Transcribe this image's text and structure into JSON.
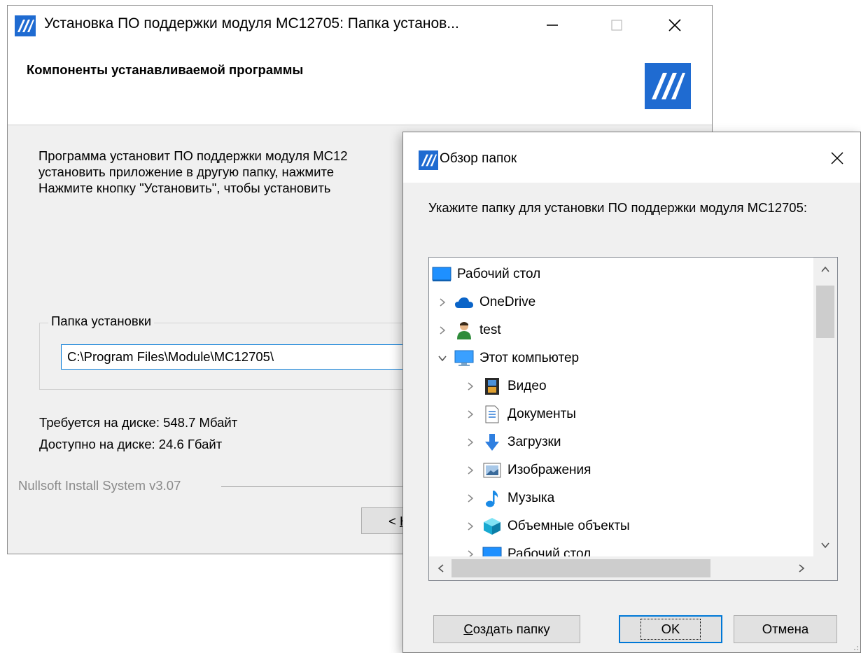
{
  "installer": {
    "title": "Установка ПО поддержки модуля MC12705: Папка установ...",
    "header_title": "Компоненты устанавливаемой программы",
    "description_lines": [
      "Программа установит ПО поддержки модуля MC12",
      "установить приложение в другую папку, нажмите",
      "Нажмите кнопку \"Установить\", чтобы установить"
    ],
    "group_label": "Папка установки",
    "install_path": "C:\\Program Files\\Module\\MC12705\\",
    "space_required": "Требуется на диске: 548.7 Мбайт",
    "space_available": "Доступно на диске: 24.6 Гбайт",
    "branding": "Nullsoft Install System v3.07",
    "back_button": {
      "prefix": "< ",
      "underlined": "Н"
    }
  },
  "browse_dialog": {
    "title": "Обзор папок",
    "prompt": "Укажите папку для установки ПО поддержки модуля MC12705:",
    "tree": [
      {
        "label": "Рабочий стол",
        "icon": "desktop-icon",
        "level": 0,
        "chevron": "none"
      },
      {
        "label": "OneDrive",
        "icon": "cloud-icon",
        "level": 1,
        "chevron": "right"
      },
      {
        "label": "test",
        "icon": "user-icon",
        "level": 1,
        "chevron": "right"
      },
      {
        "label": "Этот компьютер",
        "icon": "computer-icon",
        "level": 1,
        "chevron": "down"
      },
      {
        "label": "Видео",
        "icon": "video-icon",
        "level": 2,
        "chevron": "right"
      },
      {
        "label": "Документы",
        "icon": "document-icon",
        "level": 2,
        "chevron": "right"
      },
      {
        "label": "Загрузки",
        "icon": "download-icon",
        "level": 2,
        "chevron": "right"
      },
      {
        "label": "Изображения",
        "icon": "image-icon",
        "level": 2,
        "chevron": "right"
      },
      {
        "label": "Музыка",
        "icon": "music-icon",
        "level": 2,
        "chevron": "right"
      },
      {
        "label": "Объемные объекты",
        "icon": "3d-objects-icon",
        "level": 2,
        "chevron": "right"
      },
      {
        "label": "Рабочий стол",
        "icon": "desktop-icon",
        "level": 2,
        "chevron": "right"
      }
    ],
    "buttons": {
      "new_folder": {
        "underlined": "С",
        "rest": "оздать папку"
      },
      "ok": "OK",
      "cancel": "Отмена"
    }
  }
}
